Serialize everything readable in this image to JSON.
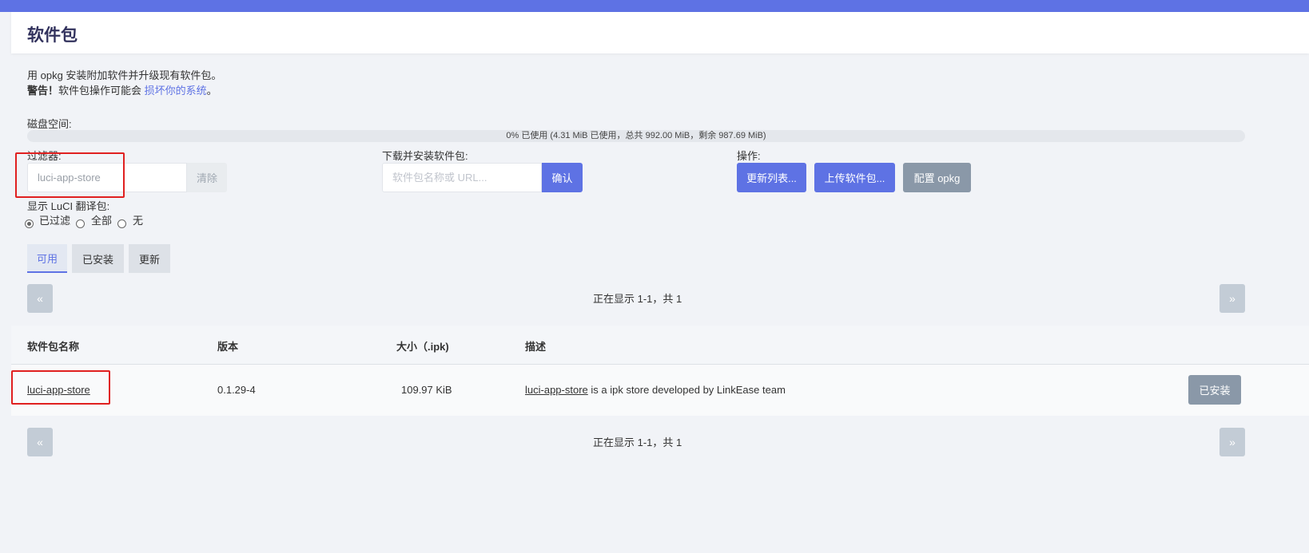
{
  "page": {
    "title": "软件包"
  },
  "intro": {
    "line1": "用 opkg 安装附加软件并升级现有软件包。",
    "warning_label": "警告！",
    "warning_text": "软件包操作可能会 ",
    "warning_link": "损坏你的系统",
    "warning_end": "。"
  },
  "disk": {
    "label": "磁盘空间:",
    "usage_text": "0% 已使用 (4.31 MiB 已使用，总共 992.00 MiB，剩余 987.69 MiB)",
    "used_percent": 0
  },
  "filter": {
    "label": "过滤器:",
    "value": "luci-app-store",
    "clear_label": "清除"
  },
  "download": {
    "label": "下载并安装软件包:",
    "placeholder": "软件包名称或 URL...",
    "confirm_label": "确认"
  },
  "actions": {
    "label": "操作:",
    "update_label": "更新列表...",
    "upload_label": "上传软件包...",
    "config_label": "配置 opkg"
  },
  "translations": {
    "label": "显示 LuCI 翻译包:",
    "options": [
      "已过滤",
      "全部",
      "无"
    ],
    "selected": "已过滤"
  },
  "tabs": [
    {
      "label": "可用",
      "active": true
    },
    {
      "label": "已安装",
      "active": false
    },
    {
      "label": "更新",
      "active": false
    }
  ],
  "pager": {
    "prev_label": "«",
    "next_label": "»",
    "info": "正在显示 1-1，共 1"
  },
  "table": {
    "headers": [
      "软件包名称",
      "版本",
      "大小（.ipk)",
      "描述"
    ],
    "rows": [
      {
        "name": "luci-app-store",
        "version": "0.1.29-4",
        "size": "109.97 KiB",
        "desc_link": "luci-app-store",
        "desc_text": " is a ipk store developed by LinkEase team",
        "action_label": "已安装"
      }
    ]
  },
  "colors": {
    "accent": "#5e72e4",
    "highlight": "#e02020",
    "gray_button": "#8a98a8"
  }
}
